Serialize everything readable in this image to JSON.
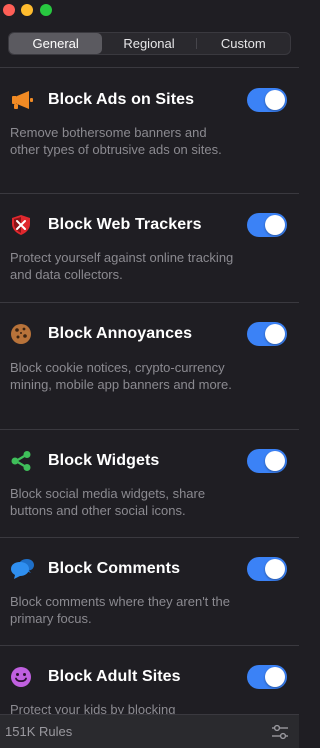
{
  "tabs": [
    "General",
    "Regional",
    "Custom"
  ],
  "active_tab": "General",
  "items": [
    {
      "title": "Block Ads on Sites",
      "description": "Remove bothersome banners and other types of obtrusive ads on sites.",
      "enabled": true,
      "icon": "megaphone-icon"
    },
    {
      "title": "Block Web Trackers",
      "description": "Protect yourself against online tracking and data collectors.",
      "enabled": true,
      "icon": "shield-icon"
    },
    {
      "title": "Block Annoyances",
      "description": "Block cookie notices, crypto-currency mining, mobile app banners and more.",
      "enabled": true,
      "icon": "cookie-icon"
    },
    {
      "title": "Block Widgets",
      "description": "Block social media widgets, share buttons and other social icons.",
      "enabled": true,
      "icon": "share-icon"
    },
    {
      "title": "Block Comments",
      "description": "Block comments where they aren't the primary focus.",
      "enabled": true,
      "icon": "comment-bubbles-icon"
    },
    {
      "title": "Block Adult Sites",
      "description": "Protect your kids by blocking",
      "enabled": true,
      "icon": "smiley-icon"
    }
  ],
  "footer": {
    "rules_count": "151K Rules",
    "settings_icon": "sliders-icon"
  },
  "colors": {
    "background": "#1f1e23",
    "toggle_on": "#3b82f6",
    "megaphone": "#f08a24",
    "shield": "#e0282e",
    "cookie": "#b8733a",
    "share": "#3fbf5a",
    "comment": "#2f8ff0",
    "smiley": "#c060e0"
  }
}
